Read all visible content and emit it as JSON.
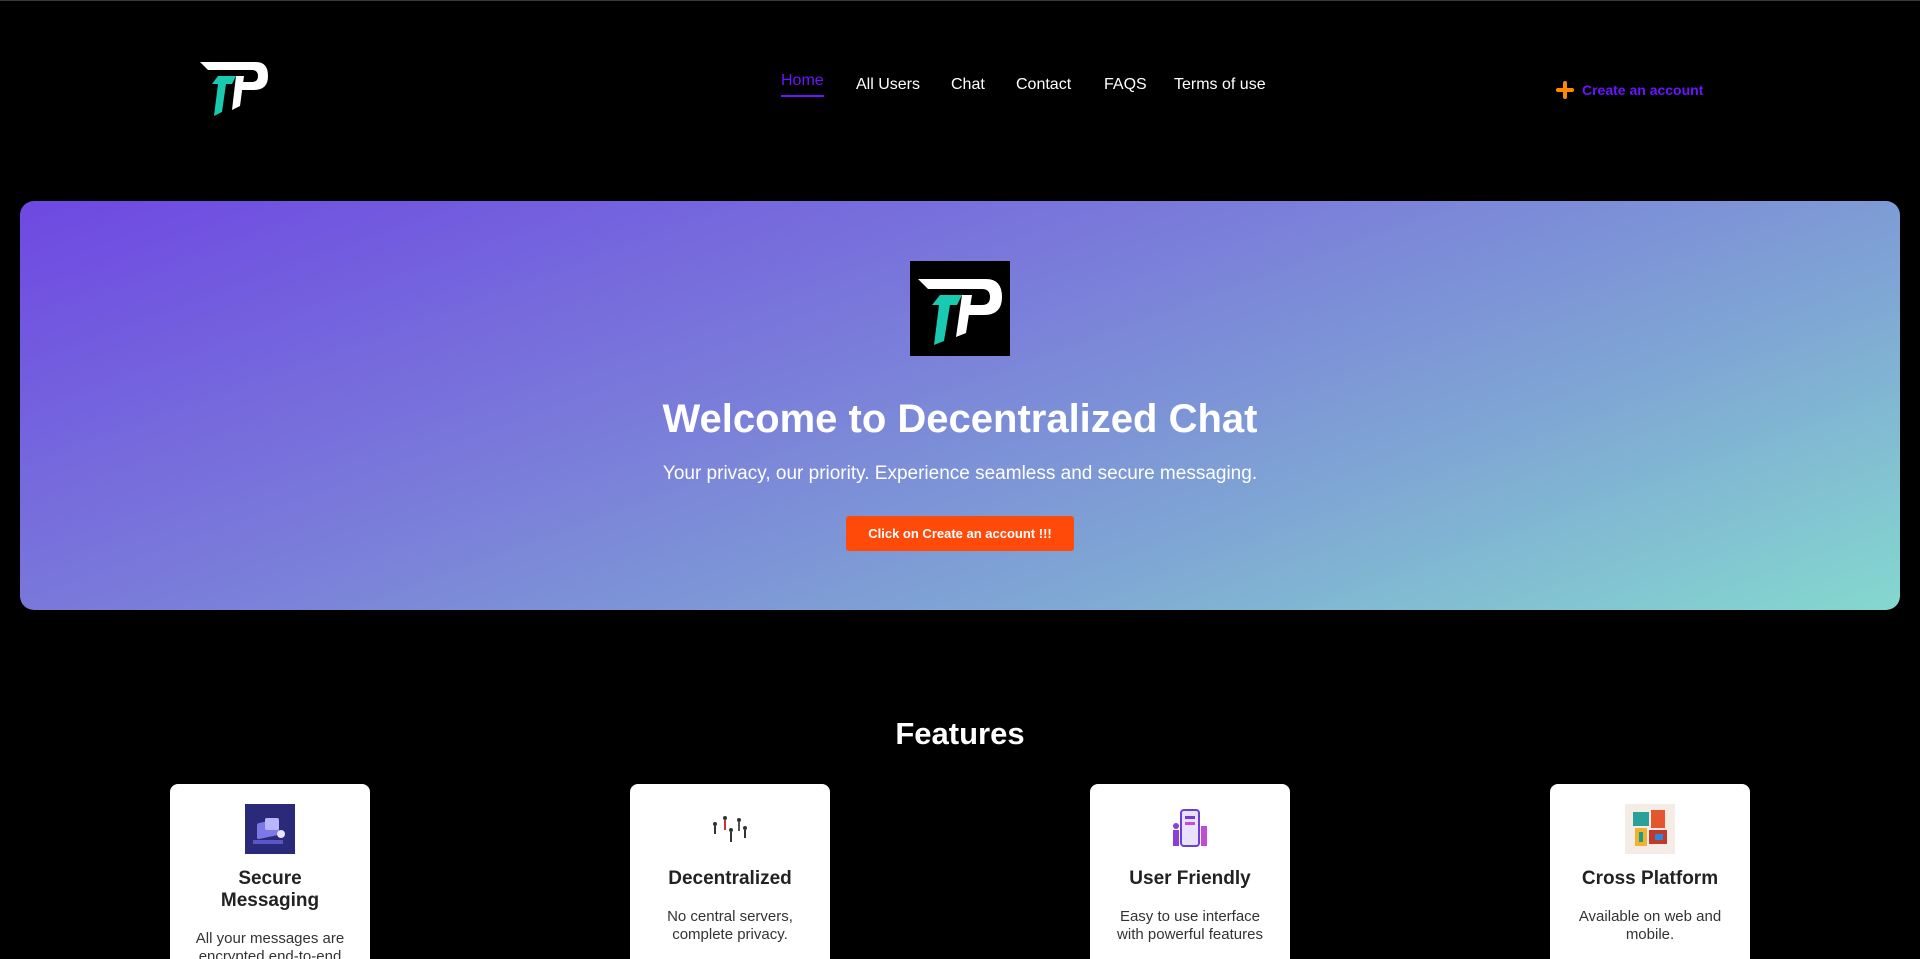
{
  "nav": {
    "items": [
      {
        "label": "Home",
        "active": true
      },
      {
        "label": "All Users",
        "active": false
      },
      {
        "label": "Chat",
        "active": false
      },
      {
        "label": "Contact",
        "active": false
      },
      {
        "label": "FAQS",
        "active": false
      },
      {
        "label": "Terms of use",
        "active": false
      }
    ],
    "create_account": "Create an account"
  },
  "hero": {
    "title": "Welcome to Decentralized Chat",
    "subtitle": "Your privacy, our priority. Experience seamless and secure messaging.",
    "button": "Click on Create an account !!!"
  },
  "features": {
    "title": "Features",
    "cards": [
      {
        "title": "Secure Messaging",
        "desc": "All your messages are encrypted end-to-end",
        "icon": "secure-messaging-icon"
      },
      {
        "title": "Decentralized",
        "desc": "No central servers, complete privacy.",
        "icon": "decentralized-icon"
      },
      {
        "title": "User Friendly",
        "desc": "Easy to use interface with powerful features",
        "icon": "user-friendly-icon"
      },
      {
        "title": "Cross Platform",
        "desc": "Available on web and mobile.",
        "icon": "cross-platform-icon"
      }
    ]
  },
  "colors": {
    "accent": "#6a14ff",
    "cta": "#ff4a0a",
    "plus": "#ff8a00"
  }
}
